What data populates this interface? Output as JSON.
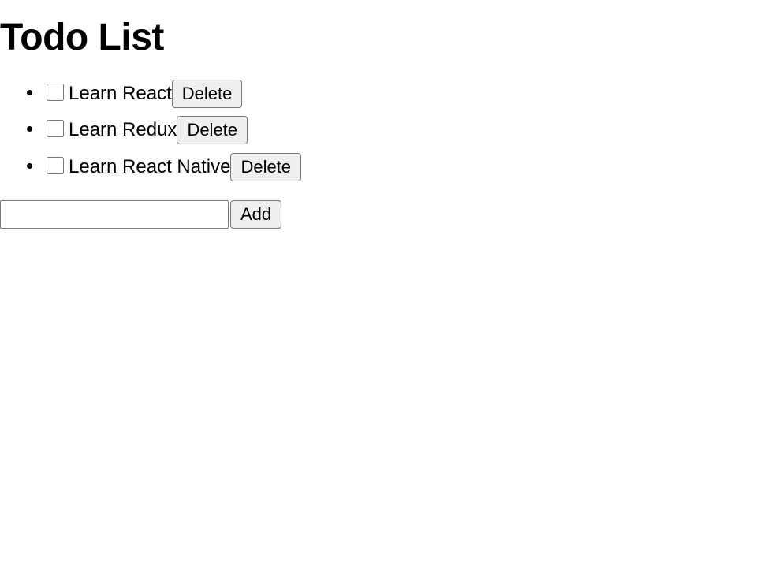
{
  "title": "Todo List",
  "todos": [
    {
      "text": "Learn React",
      "checked": false
    },
    {
      "text": "Learn Redux",
      "checked": false
    },
    {
      "text": "Learn React Native",
      "checked": false
    }
  ],
  "buttons": {
    "delete": "Delete",
    "add": "Add"
  },
  "input": {
    "value": ""
  }
}
